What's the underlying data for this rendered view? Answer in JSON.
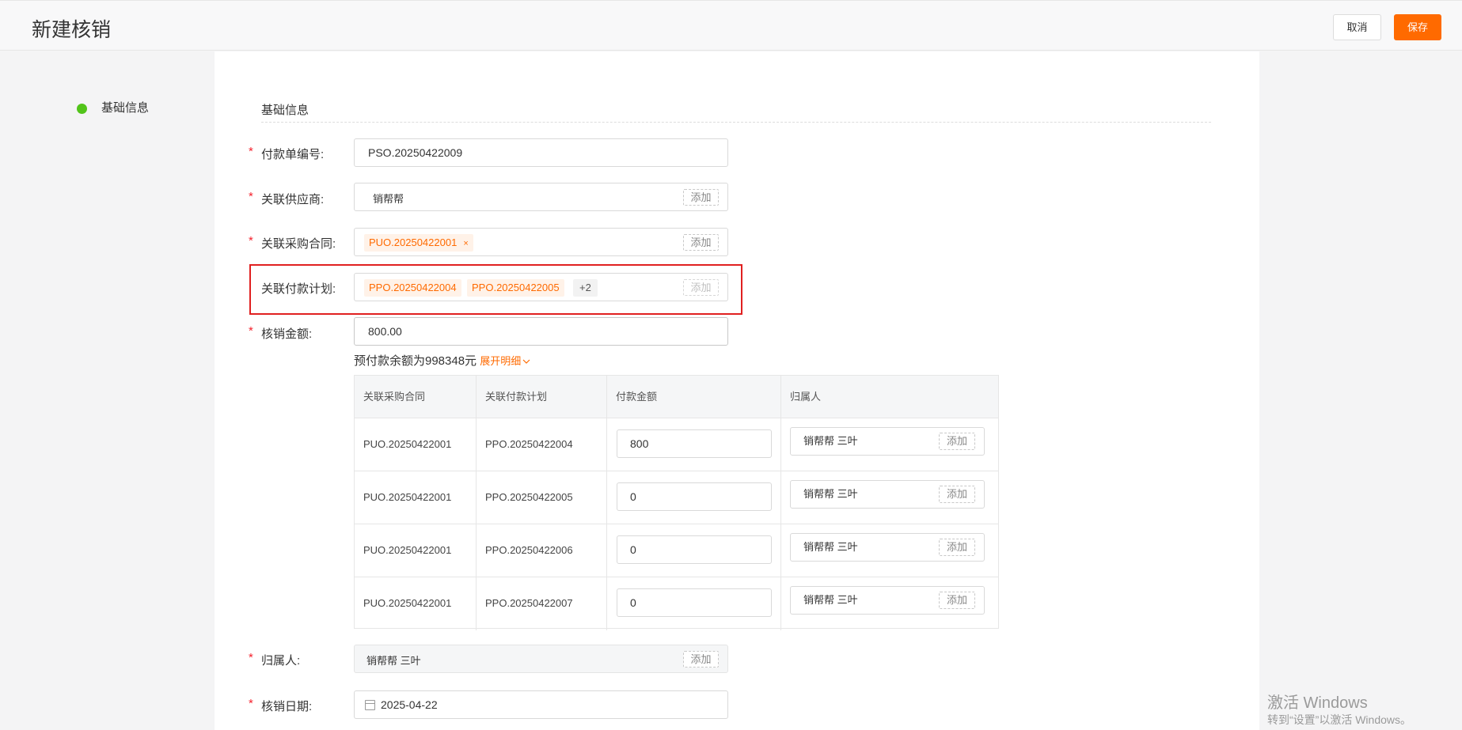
{
  "header": {
    "title": "新建核销",
    "cancel_label": "取消",
    "save_label": "保存"
  },
  "nav": {
    "item_label": "基础信息"
  },
  "section": {
    "title": "基础信息"
  },
  "form": {
    "payment_no": {
      "label": "付款单编号:",
      "value": "PSO.20250422009"
    },
    "supplier": {
      "label": "关联供应商:",
      "value": "销帮帮",
      "add_label": "添加"
    },
    "contract": {
      "label": "关联采购合同:",
      "tag": "PUO.20250422001",
      "tag_close": "×",
      "add_label": "添加"
    },
    "plan": {
      "label": "关联付款计划:",
      "tags": [
        "PPO.20250422004",
        "PPO.20250422005"
      ],
      "more": "+2",
      "add_label": "添加"
    },
    "amount": {
      "label": "核销金额:",
      "value": "800.00"
    },
    "balance": {
      "text": "预付款余额为998348元",
      "expand_label": "展开明细"
    },
    "owner": {
      "label": "归属人:",
      "value": "销帮帮 三叶",
      "add_label": "添加"
    },
    "date": {
      "label": "核销日期:",
      "value": "2025-04-22"
    }
  },
  "detail_table": {
    "headers": [
      "关联采购合同",
      "关联付款计划",
      "付款金额",
      "归属人"
    ],
    "rows": [
      {
        "contract": "PUO.20250422001",
        "plan": "PPO.20250422004",
        "amount": "800",
        "owner": "销帮帮 三叶",
        "add_label": "添加"
      },
      {
        "contract": "PUO.20250422001",
        "plan": "PPO.20250422005",
        "amount": "0",
        "owner": "销帮帮 三叶",
        "add_label": "添加"
      },
      {
        "contract": "PUO.20250422001",
        "plan": "PPO.20250422006",
        "amount": "0",
        "owner": "销帮帮 三叶",
        "add_label": "添加"
      },
      {
        "contract": "PUO.20250422001",
        "plan": "PPO.20250422007",
        "amount": "0",
        "owner": "销帮帮 三叶",
        "add_label": "添加"
      }
    ]
  },
  "required_mark": "*",
  "watermark": {
    "line1": "激活 Windows",
    "line2": "转到“设置”以激活 Windows。"
  },
  "colors": {
    "accent": "#ff6a00",
    "status_dot": "#52c41a",
    "required": "#f5222d",
    "highlight_border": "#e02020"
  }
}
